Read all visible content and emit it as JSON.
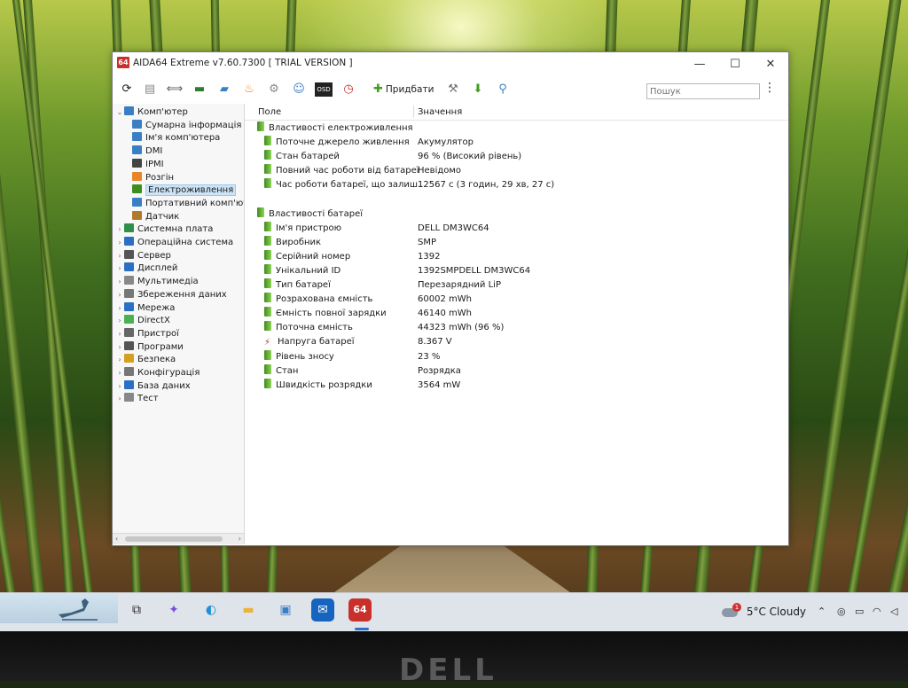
{
  "window": {
    "app_logo": "64",
    "title": "AIDA64 Extreme v7.60.7300  [ TRIAL VERSION ]",
    "minimize": "—",
    "maximize": "☐",
    "close": "✕"
  },
  "toolbar": {
    "icons": [
      "refresh-icon",
      "report-icon",
      "network-icon",
      "memory-icon",
      "computer-icon",
      "flame-icon",
      "tools-icon",
      "user-icon",
      "osd-icon",
      "clock-icon",
      "hammer-icon",
      "download-icon",
      "search-tool-icon"
    ],
    "add_label": "Придбати",
    "search_placeholder": "Пошук",
    "more": "⋮"
  },
  "tree": {
    "items": [
      {
        "label": "Комп'ютер",
        "level": 0,
        "expander": "⌄",
        "icon": "computer-icon",
        "color": "#3a7fc4"
      },
      {
        "label": "Сумарна інформація",
        "level": 1,
        "icon": "summary-icon",
        "color": "#3a7fc4"
      },
      {
        "label": "Ім'я комп'ютера",
        "level": 1,
        "icon": "computer-name-icon",
        "color": "#3a7fc4"
      },
      {
        "label": "DMI",
        "level": 1,
        "icon": "dmi-icon",
        "color": "#3a7fc4"
      },
      {
        "label": "IPMI",
        "level": 1,
        "icon": "ipmi-icon",
        "color": "#444444"
      },
      {
        "label": "Розгін",
        "level": 1,
        "icon": "flame-icon",
        "color": "#e8842a"
      },
      {
        "label": "Електроживлення",
        "level": 1,
        "icon": "power-icon",
        "color": "#3e8d1f",
        "selected": true
      },
      {
        "label": "Портативний комп'ютер",
        "level": 1,
        "icon": "laptop-icon",
        "color": "#3a7fc4"
      },
      {
        "label": "Датчик",
        "level": 1,
        "icon": "sensor-icon",
        "color": "#b07a2a"
      },
      {
        "label": "Системна плата",
        "level": 0,
        "expander": "›",
        "icon": "motherboard-icon",
        "color": "#2f8f4a"
      },
      {
        "label": "Операційна система",
        "level": 0,
        "expander": "›",
        "icon": "windows-icon",
        "color": "#2b6fc2"
      },
      {
        "label": "Сервер",
        "level": 0,
        "expander": "›",
        "icon": "server-icon",
        "color": "#555555"
      },
      {
        "label": "Дисплей",
        "level": 0,
        "expander": "›",
        "icon": "display-icon",
        "color": "#2b6fc2"
      },
      {
        "label": "Мультимедіа",
        "level": 0,
        "expander": "›",
        "icon": "multimedia-icon",
        "color": "#888888"
      },
      {
        "label": "Збереження даних",
        "level": 0,
        "expander": "›",
        "icon": "storage-icon",
        "color": "#777777"
      },
      {
        "label": "Мережа",
        "level": 0,
        "expander": "›",
        "icon": "network-icon",
        "color": "#2b6fc2"
      },
      {
        "label": "DirectX",
        "level": 0,
        "expander": "›",
        "icon": "directx-icon",
        "color": "#4caf50"
      },
      {
        "label": "Пристрої",
        "level": 0,
        "expander": "›",
        "icon": "devices-icon",
        "color": "#666666"
      },
      {
        "label": "Програми",
        "level": 0,
        "expander": "›",
        "icon": "programs-icon",
        "color": "#555555"
      },
      {
        "label": "Безпека",
        "level": 0,
        "expander": "›",
        "icon": "shield-icon",
        "color": "#d4a020"
      },
      {
        "label": "Конфігурація",
        "level": 0,
        "expander": "›",
        "icon": "config-icon",
        "color": "#777777"
      },
      {
        "label": "База даних",
        "level": 0,
        "expander": "›",
        "icon": "database-icon",
        "color": "#2b6fc2"
      },
      {
        "label": "Тест",
        "level": 0,
        "expander": "›",
        "icon": "benchmark-icon",
        "color": "#888888"
      }
    ]
  },
  "list": {
    "col_field": "Поле",
    "col_value": "Значення",
    "rows": [
      {
        "type": "group",
        "field": "Властивості електроживлення"
      },
      {
        "type": "item",
        "field": "Поточне джерело живлення",
        "value": "Акумулятор"
      },
      {
        "type": "item",
        "field": "Стан батарей",
        "value": "96 % (Високий рівень)"
      },
      {
        "type": "item",
        "field": "Повний час роботи від батареї",
        "value": "Невідомо"
      },
      {
        "type": "item",
        "field": "Час роботи батареї, що залиш...",
        "value": "12567 с (3 годин, 29 хв, 27 с)"
      },
      {
        "type": "blank"
      },
      {
        "type": "group",
        "field": "Властивості батареї"
      },
      {
        "type": "item",
        "field": "Ім'я пристрою",
        "value": "DELL DM3WC64"
      },
      {
        "type": "item",
        "field": "Виробник",
        "value": "SMP"
      },
      {
        "type": "item",
        "field": "Серійний номер",
        "value": "1392"
      },
      {
        "type": "item",
        "field": "Унікальний ID",
        "value": "1392SMPDELL DM3WC64"
      },
      {
        "type": "item",
        "field": "Тип батареї",
        "value": "Перезарядний LiP"
      },
      {
        "type": "item",
        "field": "Розрахована ємність",
        "value": "60002 mWh"
      },
      {
        "type": "item",
        "field": "Ємність повної зарядки",
        "value": "46140 mWh"
      },
      {
        "type": "item",
        "field": "Поточна ємність",
        "value": "44323 mWh  (96 %)"
      },
      {
        "type": "item",
        "field": "Напруга батареї",
        "value": "8.367 V",
        "icon": "bolt"
      },
      {
        "type": "item",
        "field": "Рівень зносу",
        "value": "23 %"
      },
      {
        "type": "item",
        "field": "Стан",
        "value": "Розрядка"
      },
      {
        "type": "item",
        "field": "Швидкість розрядки",
        "value": "3564 mW"
      }
    ]
  },
  "taskbar": {
    "apps": [
      {
        "name": "task-view-icon",
        "glyph": "⧉",
        "bg": "transparent",
        "fg": "#222"
      },
      {
        "name": "copilot-icon",
        "glyph": "✦",
        "bg": "transparent",
        "fg": "#7a4fd6"
      },
      {
        "name": "edge-icon",
        "glyph": "◐",
        "bg": "transparent",
        "fg": "#1f8fd6"
      },
      {
        "name": "file-explorer-icon",
        "glyph": "▬",
        "bg": "transparent",
        "fg": "#e8b43a"
      },
      {
        "name": "store-icon",
        "glyph": "▣",
        "bg": "transparent",
        "fg": "#3a7fc4"
      },
      {
        "name": "outlook-icon",
        "glyph": "✉",
        "bg": "#1565c0",
        "fg": "#fff"
      },
      {
        "name": "aida64-taskbar-icon",
        "glyph": "64",
        "bg": "#c9302c",
        "fg": "#fff"
      }
    ],
    "weather_badge": "1",
    "weather": "5°C  Cloudy",
    "tray_icons": [
      "chevron-up-icon",
      "copilot-tray-icon",
      "battery-icon",
      "wifi-icon",
      "volume-icon"
    ]
  },
  "bezel": {
    "brand": "DELL"
  }
}
